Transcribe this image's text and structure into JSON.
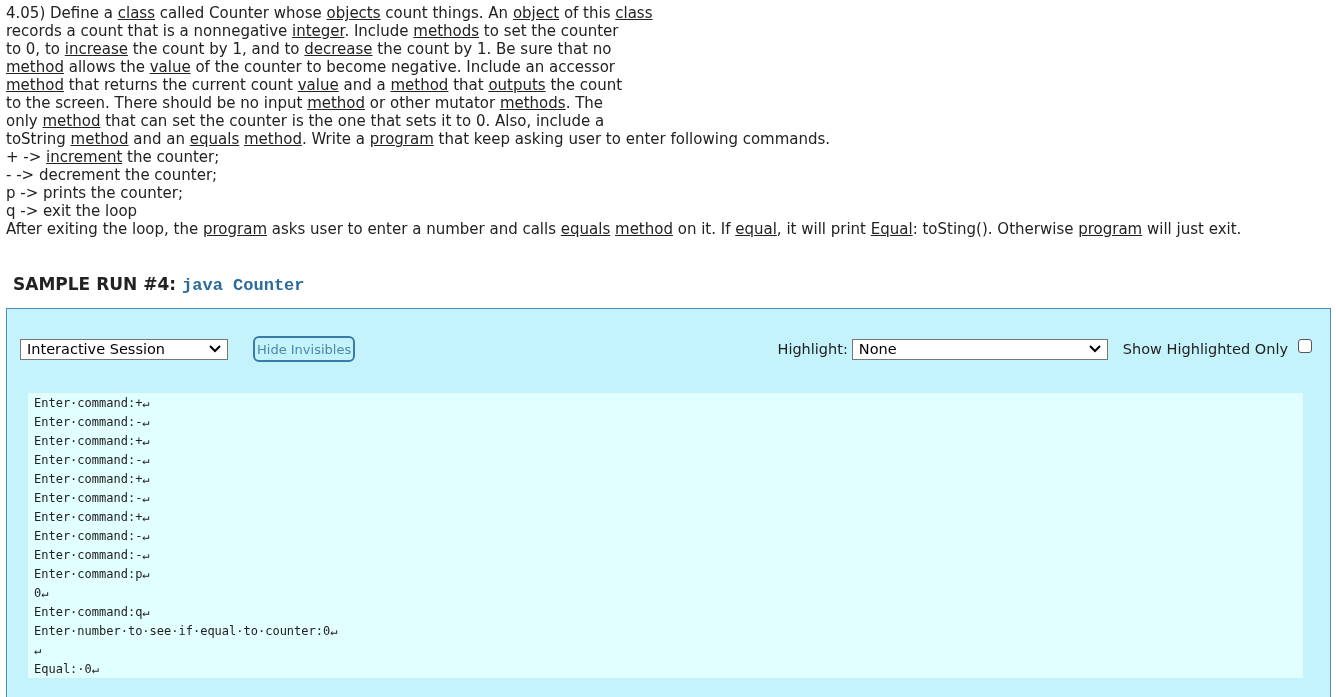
{
  "problem": {
    "lines": [
      [
        {
          "kind": "text",
          "text": "4.05) Define a "
        },
        {
          "kind": "link",
          "text": "class"
        },
        {
          "kind": "text",
          "text": " called Counter whose "
        },
        {
          "kind": "link",
          "text": "objects"
        },
        {
          "kind": "text",
          "text": " count things. An "
        },
        {
          "kind": "link",
          "text": "object"
        },
        {
          "kind": "text",
          "text": " of this "
        },
        {
          "kind": "link",
          "text": "class"
        }
      ],
      [
        {
          "kind": "text",
          "text": "records a count that is a nonnegative "
        },
        {
          "kind": "link",
          "text": "integer"
        },
        {
          "kind": "text",
          "text": ". Include "
        },
        {
          "kind": "link",
          "text": "methods"
        },
        {
          "kind": "text",
          "text": " to set the counter"
        }
      ],
      [
        {
          "kind": "text",
          "text": "to 0, to "
        },
        {
          "kind": "link",
          "text": "increase"
        },
        {
          "kind": "text",
          "text": " the count by 1, and to "
        },
        {
          "kind": "link",
          "text": "decrease"
        },
        {
          "kind": "text",
          "text": " the count by 1. Be sure that no"
        }
      ],
      [
        {
          "kind": "link",
          "text": "method"
        },
        {
          "kind": "text",
          "text": " allows the "
        },
        {
          "kind": "link",
          "text": "value"
        },
        {
          "kind": "text",
          "text": " of the counter to become negative. Include an accessor"
        }
      ],
      [
        {
          "kind": "link",
          "text": "method"
        },
        {
          "kind": "text",
          "text": " that returns the current count "
        },
        {
          "kind": "link",
          "text": "value"
        },
        {
          "kind": "text",
          "text": " and a "
        },
        {
          "kind": "link",
          "text": "method"
        },
        {
          "kind": "text",
          "text": " that "
        },
        {
          "kind": "link",
          "text": "outputs"
        },
        {
          "kind": "text",
          "text": " the count"
        }
      ],
      [
        {
          "kind": "text",
          "text": "to the screen. There should be no input "
        },
        {
          "kind": "link",
          "text": "method"
        },
        {
          "kind": "text",
          "text": " or other mutator "
        },
        {
          "kind": "link",
          "text": "methods"
        },
        {
          "kind": "text",
          "text": ". The"
        }
      ],
      [
        {
          "kind": "text",
          "text": "only "
        },
        {
          "kind": "link",
          "text": "method"
        },
        {
          "kind": "text",
          "text": " that can set the counter is the one that sets it to 0. Also, include a"
        }
      ],
      [
        {
          "kind": "text",
          "text": "toString "
        },
        {
          "kind": "link",
          "text": "method"
        },
        {
          "kind": "text",
          "text": " and an "
        },
        {
          "kind": "link",
          "text": "equals"
        },
        {
          "kind": "link",
          "text": "method"
        },
        {
          "kind": "text",
          "text": ". Write a "
        },
        {
          "kind": "link",
          "text": "program"
        },
        {
          "kind": "text",
          "text": " that keep asking user to enter following commands."
        }
      ],
      [
        {
          "kind": "text",
          "text": "+ -> "
        },
        {
          "kind": "link",
          "text": "increment"
        },
        {
          "kind": "text",
          "text": " the counter;"
        }
      ],
      [
        {
          "kind": "text",
          "text": "- -> decrement the counter;"
        }
      ],
      [
        {
          "kind": "text",
          "text": "p -> prints the counter;"
        }
      ],
      [
        {
          "kind": "text",
          "text": "q -> exit the loop"
        }
      ],
      [
        {
          "kind": "text",
          "text": "After exiting the loop, the "
        },
        {
          "kind": "link",
          "text": "program"
        },
        {
          "kind": "text",
          "text": " asks user to enter a number and calls "
        },
        {
          "kind": "link",
          "text": "equals"
        },
        {
          "kind": "link",
          "text": "method"
        },
        {
          "kind": "text",
          "text": " on it. If "
        },
        {
          "kind": "link",
          "text": "equal"
        },
        {
          "kind": "text",
          "text": ", it will print "
        },
        {
          "kind": "link",
          "text": "Equal"
        },
        {
          "kind": "text",
          "text": ": toSting(). Otherwise "
        },
        {
          "kind": "link",
          "text": "program"
        },
        {
          "kind": "text",
          "text": " will just exit."
        }
      ]
    ]
  },
  "sample_run": {
    "label": "SAMPLE RUN #4:",
    "command": "java Counter"
  },
  "controls": {
    "session_select": "Interactive Session",
    "hide_button": "Hide Invisibles",
    "highlight_label": "Highlight:",
    "highlight_select": "None",
    "show_highlighted_label": "Show Highlighted Only",
    "show_highlighted_checked": false
  },
  "transcript": [
    "Enter·command:+↵",
    "Enter·command:-↵",
    "Enter·command:+↵",
    "Enter·command:-↵",
    "Enter·command:+↵",
    "Enter·command:-↵",
    "Enter·command:+↵",
    "Enter·command:-↵",
    "Enter·command:-↵",
    "Enter·command:p↵",
    "0↵",
    "Enter·command:q↵",
    "Enter·number·to·see·if·equal·to·counter:0↵",
    "↵",
    "Equal:·0↵"
  ]
}
